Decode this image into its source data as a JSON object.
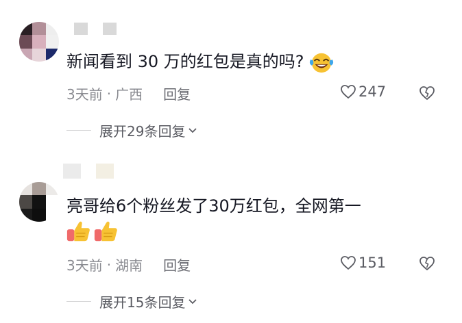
{
  "comments": [
    {
      "text": "新闻看到 30 万的红包是真的吗?",
      "emoji": "laughing-crying-emoji",
      "time": "3天前",
      "separator": "·",
      "location": "广西",
      "reply_label": "回复",
      "likes": "247",
      "expand_label": "展开29条回复"
    },
    {
      "text": "亮哥给6个粉丝发了30万红包，全网第一",
      "emoji": "thumbs-up-emoji",
      "time": "3天前",
      "separator": "·",
      "location": "湖南",
      "reply_label": "回复",
      "likes": "151",
      "expand_label": "展开15条回复"
    }
  ],
  "icons": {
    "like": "heart-outline-icon",
    "dislike": "broken-heart-icon",
    "expand": "chevron-down-icon"
  },
  "colors": {
    "text": "#161823",
    "meta": "#8a8b91",
    "emoji_yellow": "#f7c233"
  }
}
